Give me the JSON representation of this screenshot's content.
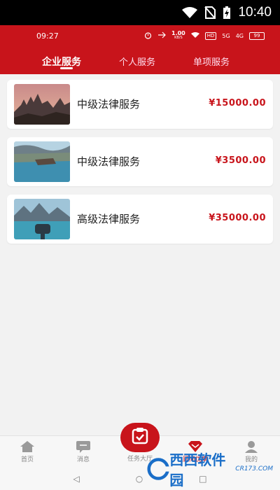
{
  "system_status": {
    "time": "10:40"
  },
  "inner_status": {
    "time": "09:27",
    "net_speed": "1.00",
    "net_unit": "KB/S",
    "hd_badge": "HD",
    "signal_1": "5G",
    "signal_2": "4G",
    "battery": "99"
  },
  "tabs": [
    {
      "label": "企业服务",
      "active": true
    },
    {
      "label": "个人服务",
      "active": false
    },
    {
      "label": "单项服务",
      "active": false
    }
  ],
  "services": [
    {
      "title": "中级法律服务",
      "price": "¥15000.00",
      "thumb_icon": "castle-photo"
    },
    {
      "title": "中级法律服务",
      "price": "¥3500.00",
      "thumb_icon": "lake-cliff-photo"
    },
    {
      "title": "高级法律服务",
      "price": "¥35000.00",
      "thumb_icon": "mountain-lake-binocular-photo"
    }
  ],
  "bottom_nav": [
    {
      "label": "首页",
      "icon": "home-icon"
    },
    {
      "label": "消息",
      "icon": "message-icon"
    },
    {
      "label": "任务大厅",
      "icon": "task-icon"
    },
    {
      "label": "顾问优享",
      "icon": "diamond-icon",
      "active": true
    },
    {
      "label": "我的",
      "icon": "profile-icon"
    }
  ],
  "watermark": {
    "text": "西西软件园",
    "url": "CR173.COM"
  },
  "colors": {
    "brand": "#c8141b",
    "background": "#f2f2f2"
  }
}
